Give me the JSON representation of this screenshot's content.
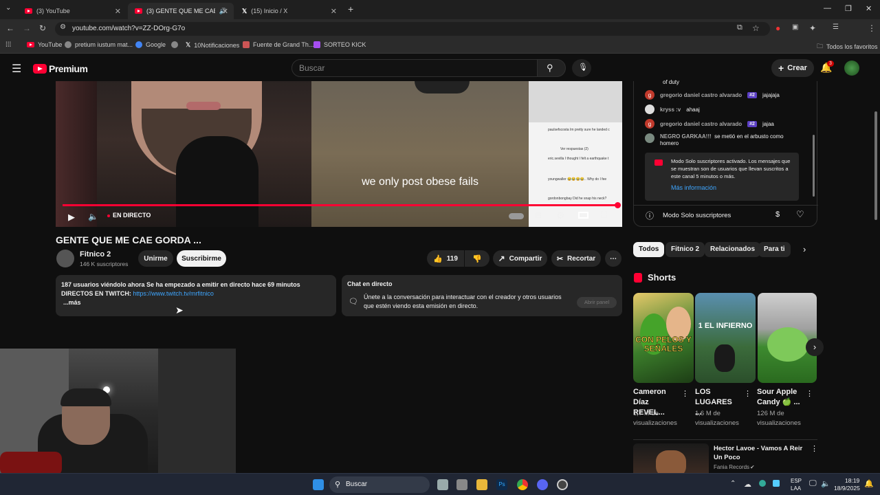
{
  "browser": {
    "tabs": [
      {
        "title": "(3) YouTube"
      },
      {
        "title": "(3) GENTE QUE ME CAE GC"
      },
      {
        "title": "(15) Inicio / X"
      }
    ],
    "url": "youtube.com/watch?v=ZZ-DOrg-G7o",
    "bookmarks": [
      "YouTube",
      "pretium iustum mat...",
      "Google",
      "10Notificaciones",
      "Fuente de Grand Th...",
      "SORTEO KICK"
    ],
    "all_bookmarks": "Todos los favoritos"
  },
  "header": {
    "logo": "Premium",
    "search_placeholder": "Buscar",
    "create": "Crear",
    "notif_count": "3"
  },
  "player": {
    "live_label": "EN DIRECTO",
    "subtitle": "we only post obese fails",
    "embedded_comments": [
      "paulsefscosta Im pretty sure he landed c",
      "Ver respuestas (2)",
      "eric.sevilla I thought I felt a earthquake t",
      "youngwaller 😂😂😂😂.. Why do I fee",
      "gordonbongbay Did he snap his neck?"
    ],
    "progress": 1.0
  },
  "video": {
    "title": "GENTE QUE ME CAE GORDA ...",
    "channel": "Fitnico 2",
    "subscribers": "146 K suscriptores",
    "join": "Unirme",
    "subscribe": "Suscribirme",
    "likes": "119",
    "share": "Compartir",
    "clip": "Recortar"
  },
  "description": {
    "line1": "187 usuarios viéndolo ahora  Se ha empezado a emitir en directo hace 69 minutos",
    "line2_prefix": "DIRECTOS EN TWITCH: ",
    "link": "https://www.twitch.tv/mrfitnico",
    "more": "...más"
  },
  "live_chat_box": {
    "title": "Chat en directo",
    "text": "Únete a la conversación para interactuar con el creador y otros usuarios que estén viendo esta emisión en directo.",
    "button": "Abrir panel"
  },
  "chat": {
    "partial": "of duty",
    "messages": [
      {
        "author": "gregorio daniel castro alvarado",
        "badge": "#2",
        "text": "jajajaja",
        "avatar": "g",
        "color": "#c0392b"
      },
      {
        "author": "kryss :v",
        "badge": "",
        "text": "ahaaj",
        "avatar": "",
        "color": "#dddddd"
      },
      {
        "author": "gregorio daniel castro alvarado",
        "badge": "#2",
        "text": "jajaa",
        "avatar": "g",
        "color": "#c0392b"
      },
      {
        "author": "NEGRO GARKAA!!!",
        "badge": "",
        "text": "se metió en el arbusto como homero",
        "avatar": "",
        "color": "#7a8a80"
      }
    ],
    "notice": "Modo Solo suscriptores activado. Los mensajes que se muestran son de usuarios que llevan suscritos a este canal 5 minutos o más.",
    "notice_link": "Más información",
    "mode": "Modo Solo suscriptores"
  },
  "chips": [
    "Todos",
    "Fitnico 2",
    "Relacionados",
    "Para ti"
  ],
  "shorts": {
    "heading": "Shorts",
    "items": [
      {
        "title": "Cameron Díaz REVEL...",
        "views": "1,7 M de visualizaciones",
        "thumb_text": "CON PELOS Y SEÑALES"
      },
      {
        "title": "LOS LUGARES ...",
        "views": "1,6 M de visualizaciones",
        "thumb_text": "1 EL INFIERNO"
      },
      {
        "title": "Sour Apple Candy 🍏 ...",
        "views": "126 M de visualizaciones",
        "thumb_text": ""
      }
    ]
  },
  "next_video": {
    "title": "Hector Lavoe - Vamos A Reir Un Poco",
    "channel": "Fania Records"
  },
  "taskbar": {
    "search": "Buscar",
    "lang1": "ESP",
    "lang2": "LAA",
    "time": "18:19",
    "date": "18/9/2025"
  }
}
